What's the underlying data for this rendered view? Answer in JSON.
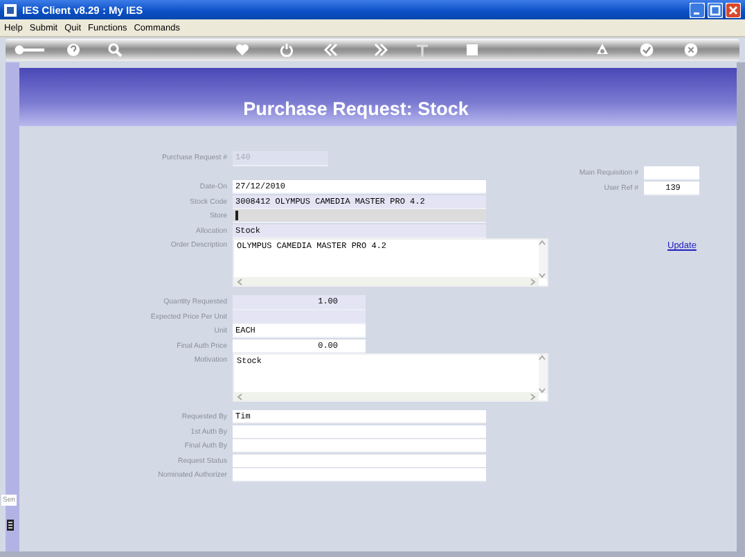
{
  "window": {
    "title": "IES Client v8.29 : My IES"
  },
  "menu": [
    "Help",
    "Submit",
    "Quit",
    "Functions",
    "Commands"
  ],
  "header": {
    "title": "Purchase Request: Stock"
  },
  "request_no": {
    "label": "Purchase Request #",
    "value": "140",
    "disabled": true
  },
  "side_fields": [
    {
      "label": "Main Requisition #"
    },
    {
      "label": "User Ref #",
      "value": "139"
    }
  ],
  "update_link": "Update",
  "item_fields": [
    {
      "label": "Date-On",
      "value": "27/12/2010",
      "kind": "line",
      "color": "#ffffff"
    },
    {
      "label": "Stock Code",
      "value": "3008412 OLYMPUS CAMEDIA MASTER PRO 4.2",
      "kind": "line",
      "color": "#e4e4f4"
    },
    {
      "label": "Store",
      "kind": "caret",
      "color": "#dcdcdc"
    },
    {
      "label": "Allocation",
      "value": "Stock",
      "kind": "line",
      "color": "#e4e4f4"
    },
    {
      "label": "Order Description",
      "value": "OLYMPUS CAMEDIA MASTER PRO 4.2",
      "kind": "memo",
      "color": "#ffffff"
    }
  ],
  "price_fields": [
    {
      "label": "Quantity Requested",
      "value": "1.00",
      "kind": "number",
      "color": "#e4e4f4"
    },
    {
      "label": "Expected Price Per Unit",
      "kind": "number",
      "color": "#e4e4f4"
    },
    {
      "label": "Unit",
      "value": "EACH",
      "kind": "line",
      "color": "#ffffff"
    },
    {
      "label": "Final Auth Price",
      "value": "0.00",
      "kind": "number",
      "color": "#ffffff"
    },
    {
      "label": "Motivation",
      "value": "Stock",
      "kind": "memo",
      "color": "#ffffff"
    }
  ],
  "auth_fields": [
    {
      "label": "Requested By",
      "value": "Tim"
    },
    {
      "label": "1st Auth By"
    },
    {
      "label": "Final Auth By"
    },
    {
      "label": "Request Status"
    },
    {
      "label": "Nominated Authorizer"
    }
  ],
  "side_tab": "Sen"
}
